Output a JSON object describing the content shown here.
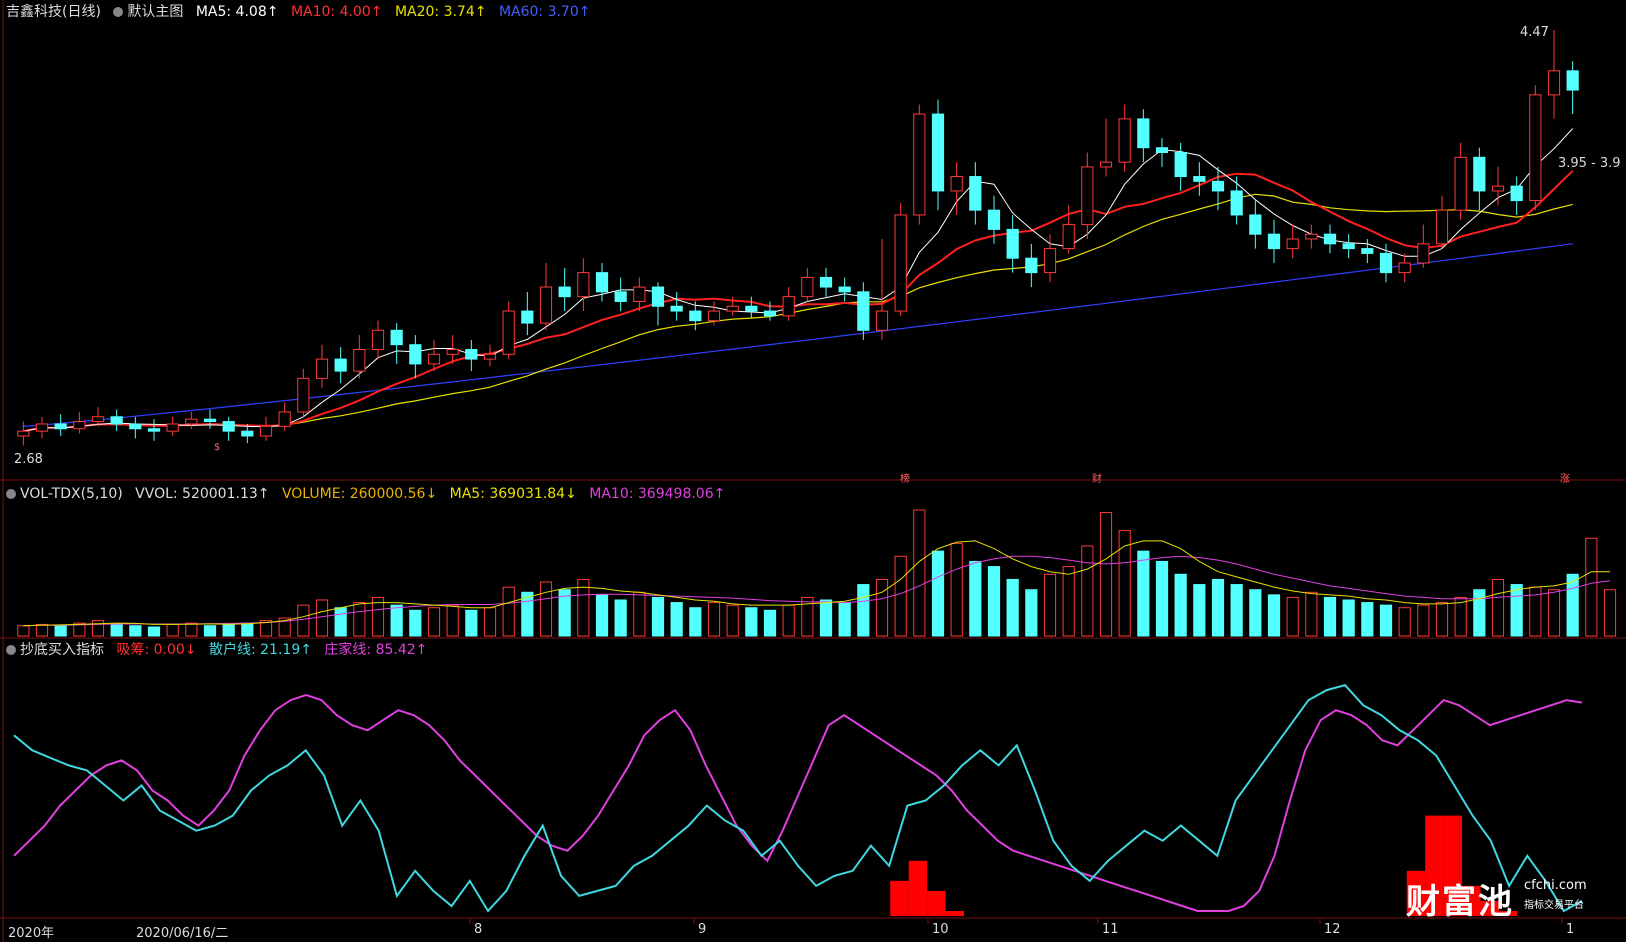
{
  "main_header": {
    "stock": "吉鑫科技(日线)",
    "chart_label": "默认主图",
    "ma5": "MA5: 4.08↑",
    "ma10": "MA10: 4.00↑",
    "ma20": "MA20: 3.74↑",
    "ma60": "MA60: 3.70↑"
  },
  "vol_header": {
    "name": "VOL-TDX(5,10)",
    "vvol": "VVOL: 520001.13↑",
    "volume": "VOLUME: 260000.56↓",
    "ma5": "MA5: 369031.84↓",
    "ma10": "MA10: 369498.06↑"
  },
  "ind_header": {
    "name": "抄底买入指标",
    "xichou": "吸筹: 0.00↓",
    "sanhu": "散户线: 21.19↑",
    "zhuangjia": "庄家线: 85.42↑"
  },
  "price_labels": {
    "high": "4.47",
    "low": "2.68",
    "range": "3.95 - 3.9"
  },
  "markers": [
    "榜",
    "财",
    "涨",
    "$"
  ],
  "x_axis": {
    "year": "2020年",
    "cursor_date": "2020/06/16/二",
    "months": [
      "8",
      "9",
      "10",
      "11",
      "12",
      "1"
    ]
  },
  "watermark": {
    "brand": "财富池",
    "site": "cfchi.com",
    "tag": "指标交易平台"
  },
  "colors": {
    "up": "#ff3a3a",
    "down": "#54ffff",
    "ma5": "#ffffff",
    "ma10": "#ff2020",
    "ma20": "#e8e000",
    "ma60": "#3040ff",
    "vol_ma10": "#e040e0",
    "sanhu": "#40d8e0",
    "zhuangjia": "#e040e0"
  },
  "chart_data": {
    "type": "candlestick",
    "price_range": [
      2.68,
      4.47
    ],
    "candles": [
      {
        "o": 2.78,
        "c": 2.8,
        "h": 2.84,
        "l": 2.74
      },
      {
        "o": 2.8,
        "c": 2.83,
        "h": 2.86,
        "l": 2.77
      },
      {
        "o": 2.83,
        "c": 2.81,
        "h": 2.87,
        "l": 2.78
      },
      {
        "o": 2.81,
        "c": 2.84,
        "h": 2.88,
        "l": 2.79
      },
      {
        "o": 2.84,
        "c": 2.86,
        "h": 2.9,
        "l": 2.82
      },
      {
        "o": 2.86,
        "c": 2.83,
        "h": 2.89,
        "l": 2.8
      },
      {
        "o": 2.83,
        "c": 2.81,
        "h": 2.86,
        "l": 2.77
      },
      {
        "o": 2.81,
        "c": 2.8,
        "h": 2.85,
        "l": 2.76
      },
      {
        "o": 2.8,
        "c": 2.83,
        "h": 2.86,
        "l": 2.78
      },
      {
        "o": 2.83,
        "c": 2.85,
        "h": 2.88,
        "l": 2.81
      },
      {
        "o": 2.85,
        "c": 2.84,
        "h": 2.89,
        "l": 2.81
      },
      {
        "o": 2.84,
        "c": 2.8,
        "h": 2.86,
        "l": 2.76
      },
      {
        "o": 2.8,
        "c": 2.78,
        "h": 2.83,
        "l": 2.75
      },
      {
        "o": 2.78,
        "c": 2.82,
        "h": 2.86,
        "l": 2.76
      },
      {
        "o": 2.82,
        "c": 2.88,
        "h": 2.92,
        "l": 2.8
      },
      {
        "o": 2.88,
        "c": 3.02,
        "h": 3.06,
        "l": 2.86
      },
      {
        "o": 3.02,
        "c": 3.1,
        "h": 3.16,
        "l": 2.98
      },
      {
        "o": 3.1,
        "c": 3.05,
        "h": 3.15,
        "l": 3.0
      },
      {
        "o": 3.05,
        "c": 3.14,
        "h": 3.2,
        "l": 3.02
      },
      {
        "o": 3.14,
        "c": 3.22,
        "h": 3.26,
        "l": 3.1
      },
      {
        "o": 3.22,
        "c": 3.16,
        "h": 3.25,
        "l": 3.08
      },
      {
        "o": 3.16,
        "c": 3.08,
        "h": 3.2,
        "l": 3.02
      },
      {
        "o": 3.08,
        "c": 3.12,
        "h": 3.18,
        "l": 3.05
      },
      {
        "o": 3.12,
        "c": 3.14,
        "h": 3.2,
        "l": 3.08
      },
      {
        "o": 3.14,
        "c": 3.1,
        "h": 3.18,
        "l": 3.05
      },
      {
        "o": 3.1,
        "c": 3.12,
        "h": 3.16,
        "l": 3.07
      },
      {
        "o": 3.12,
        "c": 3.3,
        "h": 3.34,
        "l": 3.1
      },
      {
        "o": 3.3,
        "c": 3.25,
        "h": 3.38,
        "l": 3.2
      },
      {
        "o": 3.25,
        "c": 3.4,
        "h": 3.5,
        "l": 3.22
      },
      {
        "o": 3.4,
        "c": 3.36,
        "h": 3.48,
        "l": 3.3
      },
      {
        "o": 3.36,
        "c": 3.46,
        "h": 3.52,
        "l": 3.3
      },
      {
        "o": 3.46,
        "c": 3.38,
        "h": 3.5,
        "l": 3.34
      },
      {
        "o": 3.38,
        "c": 3.34,
        "h": 3.44,
        "l": 3.3
      },
      {
        "o": 3.34,
        "c": 3.4,
        "h": 3.44,
        "l": 3.3
      },
      {
        "o": 3.4,
        "c": 3.32,
        "h": 3.42,
        "l": 3.24
      },
      {
        "o": 3.32,
        "c": 3.3,
        "h": 3.38,
        "l": 3.26
      },
      {
        "o": 3.3,
        "c": 3.26,
        "h": 3.34,
        "l": 3.22
      },
      {
        "o": 3.26,
        "c": 3.3,
        "h": 3.34,
        "l": 3.24
      },
      {
        "o": 3.3,
        "c": 3.32,
        "h": 3.36,
        "l": 3.28
      },
      {
        "o": 3.32,
        "c": 3.3,
        "h": 3.36,
        "l": 3.27
      },
      {
        "o": 3.3,
        "c": 3.28,
        "h": 3.34,
        "l": 3.26
      },
      {
        "o": 3.28,
        "c": 3.36,
        "h": 3.4,
        "l": 3.26
      },
      {
        "o": 3.36,
        "c": 3.44,
        "h": 3.48,
        "l": 3.34
      },
      {
        "o": 3.44,
        "c": 3.4,
        "h": 3.48,
        "l": 3.36
      },
      {
        "o": 3.4,
        "c": 3.38,
        "h": 3.44,
        "l": 3.34
      },
      {
        "o": 3.38,
        "c": 3.22,
        "h": 3.42,
        "l": 3.18
      },
      {
        "o": 3.22,
        "c": 3.3,
        "h": 3.6,
        "l": 3.18
      },
      {
        "o": 3.3,
        "c": 3.7,
        "h": 3.75,
        "l": 3.28
      },
      {
        "o": 3.7,
        "c": 4.12,
        "h": 4.16,
        "l": 3.66
      },
      {
        "o": 4.12,
        "c": 3.8,
        "h": 4.18,
        "l": 3.72
      },
      {
        "o": 3.8,
        "c": 3.86,
        "h": 3.92,
        "l": 3.7
      },
      {
        "o": 3.86,
        "c": 3.72,
        "h": 3.92,
        "l": 3.66
      },
      {
        "o": 3.72,
        "c": 3.64,
        "h": 3.78,
        "l": 3.58
      },
      {
        "o": 3.64,
        "c": 3.52,
        "h": 3.7,
        "l": 3.46
      },
      {
        "o": 3.52,
        "c": 3.46,
        "h": 3.58,
        "l": 3.4
      },
      {
        "o": 3.46,
        "c": 3.56,
        "h": 3.62,
        "l": 3.42
      },
      {
        "o": 3.56,
        "c": 3.66,
        "h": 3.74,
        "l": 3.54
      },
      {
        "o": 3.66,
        "c": 3.9,
        "h": 3.96,
        "l": 3.6
      },
      {
        "o": 3.9,
        "c": 3.92,
        "h": 4.1,
        "l": 3.86
      },
      {
        "o": 3.92,
        "c": 4.1,
        "h": 4.16,
        "l": 3.88
      },
      {
        "o": 4.1,
        "c": 3.98,
        "h": 4.14,
        "l": 3.92
      },
      {
        "o": 3.98,
        "c": 3.96,
        "h": 4.02,
        "l": 3.9
      },
      {
        "o": 3.96,
        "c": 3.86,
        "h": 4.0,
        "l": 3.8
      },
      {
        "o": 3.86,
        "c": 3.84,
        "h": 3.92,
        "l": 3.78
      },
      {
        "o": 3.84,
        "c": 3.8,
        "h": 3.9,
        "l": 3.72
      },
      {
        "o": 3.8,
        "c": 3.7,
        "h": 3.86,
        "l": 3.66
      },
      {
        "o": 3.7,
        "c": 3.62,
        "h": 3.76,
        "l": 3.56
      },
      {
        "o": 3.62,
        "c": 3.56,
        "h": 3.68,
        "l": 3.5
      },
      {
        "o": 3.56,
        "c": 3.6,
        "h": 3.66,
        "l": 3.52
      },
      {
        "o": 3.6,
        "c": 3.62,
        "h": 3.66,
        "l": 3.56
      },
      {
        "o": 3.62,
        "c": 3.58,
        "h": 3.66,
        "l": 3.54
      },
      {
        "o": 3.58,
        "c": 3.56,
        "h": 3.62,
        "l": 3.52
      },
      {
        "o": 3.56,
        "c": 3.54,
        "h": 3.6,
        "l": 3.5
      },
      {
        "o": 3.54,
        "c": 3.46,
        "h": 3.58,
        "l": 3.42
      },
      {
        "o": 3.46,
        "c": 3.5,
        "h": 3.54,
        "l": 3.42
      },
      {
        "o": 3.5,
        "c": 3.58,
        "h": 3.66,
        "l": 3.48
      },
      {
        "o": 3.58,
        "c": 3.72,
        "h": 3.78,
        "l": 3.56
      },
      {
        "o": 3.72,
        "c": 3.94,
        "h": 4.0,
        "l": 3.68
      },
      {
        "o": 3.94,
        "c": 3.8,
        "h": 3.98,
        "l": 3.72
      },
      {
        "o": 3.8,
        "c": 3.82,
        "h": 3.9,
        "l": 3.74
      },
      {
        "o": 3.82,
        "c": 3.76,
        "h": 3.86,
        "l": 3.7
      },
      {
        "o": 3.76,
        "c": 4.2,
        "h": 4.24,
        "l": 3.72
      },
      {
        "o": 4.2,
        "c": 4.3,
        "h": 4.47,
        "l": 4.1
      },
      {
        "o": 4.3,
        "c": 4.22,
        "h": 4.34,
        "l": 4.12
      }
    ],
    "volume": [
      8,
      9,
      8,
      10,
      12,
      9,
      8,
      7,
      9,
      10,
      8,
      9,
      10,
      12,
      14,
      24,
      28,
      22,
      26,
      30,
      24,
      20,
      22,
      24,
      20,
      22,
      38,
      34,
      42,
      36,
      44,
      32,
      28,
      34,
      30,
      26,
      22,
      26,
      24,
      22,
      20,
      24,
      30,
      28,
      26,
      40,
      44,
      62,
      98,
      66,
      72,
      58,
      54,
      44,
      36,
      48,
      54,
      70,
      96,
      82,
      66,
      58,
      48,
      40,
      44,
      40,
      36,
      32,
      30,
      34,
      30,
      28,
      26,
      24,
      22,
      24,
      26,
      30,
      36,
      44,
      40,
      38,
      36,
      48,
      76,
      36
    ],
    "vol_ma5": [
      8,
      8.5,
      8.6,
      9,
      9.5,
      10,
      9.8,
      9,
      9,
      9.2,
      9.4,
      9.2,
      9.6,
      10.4,
      12,
      15,
      19,
      22,
      25,
      26,
      26,
      25,
      24,
      23,
      22,
      22,
      26,
      30,
      34,
      37,
      38,
      37,
      35,
      34,
      32,
      30,
      28,
      27,
      25,
      24,
      24,
      24,
      25,
      26,
      27,
      30,
      34,
      44,
      58,
      68,
      73,
      74,
      68,
      60,
      54,
      50,
      48,
      52,
      60,
      70,
      74,
      74,
      68,
      58,
      50,
      46,
      42,
      38,
      35,
      33,
      32,
      31,
      29,
      28,
      26,
      25,
      25,
      26,
      29,
      33,
      36,
      38,
      39,
      42,
      50,
      50
    ],
    "vol_ma10": [
      8,
      8.3,
      8.4,
      8.6,
      9,
      9.3,
      9.4,
      9.3,
      9.3,
      9.4,
      9.6,
      9.8,
      10,
      10.5,
      11.5,
      13,
      15,
      17,
      19,
      20.5,
      22,
      23,
      24,
      24.5,
      24.5,
      24.5,
      25.5,
      27,
      29,
      31,
      32,
      32.5,
      32.5,
      32,
      31.5,
      31,
      30.5,
      30,
      29.5,
      28.5,
      27.5,
      27,
      26.5,
      26.5,
      26,
      27,
      29,
      33,
      39,
      46,
      52,
      57,
      60,
      62,
      62,
      61,
      59,
      57,
      56,
      57,
      59,
      61,
      62,
      61,
      59,
      56,
      52,
      48,
      45,
      42,
      39,
      37,
      35,
      33,
      31,
      30,
      29,
      29,
      29,
      30,
      31,
      32,
      34,
      37,
      41,
      43
    ],
    "sanhu": [
      72,
      66,
      63,
      60,
      58,
      52,
      46,
      52,
      42,
      38,
      34,
      36,
      40,
      50,
      56,
      60,
      66,
      56,
      36,
      46,
      34,
      8,
      18,
      10,
      4,
      14,
      2,
      10,
      24,
      36,
      16,
      8,
      10,
      12,
      20,
      24,
      30,
      36,
      44,
      38,
      34,
      24,
      30,
      20,
      12,
      16,
      18,
      28,
      20,
      44,
      46,
      52,
      60,
      66,
      60,
      68,
      50,
      30,
      20,
      14,
      22,
      28,
      34,
      30,
      36,
      30,
      24,
      46,
      56,
      66,
      76,
      86,
      90,
      92,
      84,
      80,
      74,
      70,
      64,
      52,
      40,
      30,
      12,
      24,
      14,
      2,
      6
    ],
    "zhuangjia": [
      24,
      30,
      36,
      44,
      50,
      56,
      60,
      62,
      58,
      50,
      46,
      40,
      36,
      42,
      50,
      64,
      74,
      82,
      86,
      88,
      86,
      80,
      76,
      74,
      78,
      82,
      80,
      76,
      70,
      62,
      56,
      50,
      44,
      38,
      32,
      28,
      26,
      32,
      40,
      50,
      60,
      72,
      78,
      82,
      74,
      60,
      48,
      36,
      28,
      22,
      34,
      48,
      62,
      76,
      80,
      76,
      72,
      68,
      64,
      60,
      56,
      50,
      42,
      36,
      30,
      26,
      24,
      22,
      20,
      18,
      16,
      14,
      12,
      10,
      8,
      6,
      4,
      2,
      2,
      2,
      4,
      10,
      24,
      46,
      66,
      78,
      82,
      80,
      76,
      70,
      68,
      74,
      80,
      86,
      84,
      80,
      76,
      78,
      80,
      82,
      84,
      86,
      85
    ],
    "xichou": [
      0,
      0,
      0,
      0,
      0,
      0,
      0,
      0,
      0,
      0,
      0,
      0,
      0,
      0,
      0,
      0,
      0,
      0,
      0,
      0,
      0,
      0,
      0,
      0,
      0,
      0,
      0,
      0,
      0,
      0,
      0,
      0,
      0,
      0,
      0,
      0,
      0,
      0,
      0,
      0,
      0,
      0,
      0,
      0,
      0,
      0,
      0,
      0,
      14,
      22,
      10,
      2,
      0,
      0,
      0,
      0,
      0,
      0,
      0,
      0,
      0,
      0,
      0,
      0,
      0,
      0,
      0,
      0,
      0,
      0,
      0,
      0,
      0,
      0,
      0,
      0,
      18,
      40,
      40,
      12,
      6,
      2,
      0,
      0,
      0,
      0
    ]
  }
}
